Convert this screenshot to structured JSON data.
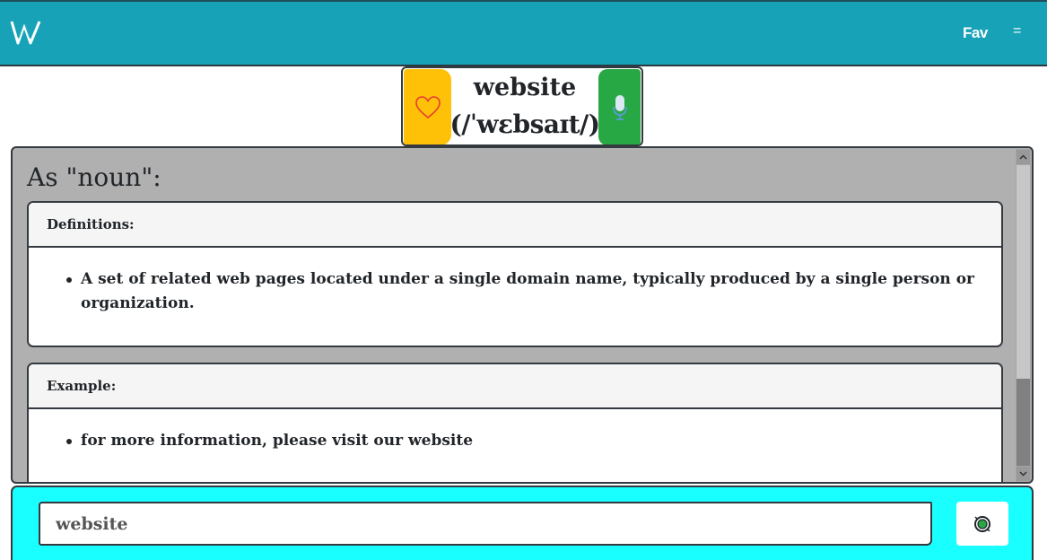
{
  "navbar": {
    "logo": "W",
    "fav_label": "Fav",
    "menu_label": "="
  },
  "word": {
    "title": "website",
    "phonetic": "(/ˈwɛbsaɪt/)"
  },
  "main": {
    "part_of_speech": "As \"noun\":",
    "definitions_header": "Definitions:",
    "definitions": [
      "A set of related web pages located under a single domain name, typically produced by a single person or organization."
    ],
    "example_header": "Example:",
    "examples": [
      "for more information, please visit our website"
    ]
  },
  "search": {
    "value": "website"
  },
  "icons": {
    "favorite": "heart-outline-icon",
    "microphone": "microphone-icon",
    "search": "search-icon"
  },
  "colors": {
    "navbar": "#17a2b8",
    "favorite_button": "#ffc107",
    "mic_button": "#28a745",
    "panel": "#b0b0b0",
    "search_bar": "#19ffff"
  }
}
